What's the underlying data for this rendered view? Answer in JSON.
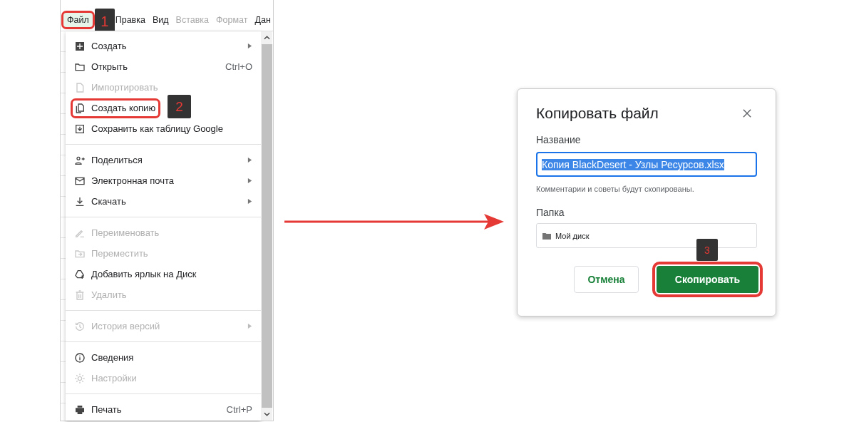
{
  "menubar": [
    {
      "label": "Файл",
      "disabled": false,
      "selected": true,
      "highlighted": true,
      "badge": "1"
    },
    {
      "label": "Правка",
      "disabled": false,
      "selected": false,
      "highlighted": false
    },
    {
      "label": "Вид",
      "disabled": false,
      "selected": false,
      "highlighted": false
    },
    {
      "label": "Вставка",
      "disabled": true,
      "selected": false,
      "highlighted": false
    },
    {
      "label": "Формат",
      "disabled": true,
      "selected": false,
      "highlighted": false
    },
    {
      "label": "Дан",
      "disabled": false,
      "selected": false,
      "highlighted": false
    }
  ],
  "menu": {
    "items": [
      {
        "kind": "item",
        "label": "Создать",
        "submenu": true,
        "disabled": false,
        "highlighted": false
      },
      {
        "kind": "item",
        "label": "Открыть",
        "shortcut": "Ctrl+O",
        "submenu": false,
        "disabled": false,
        "highlighted": false
      },
      {
        "kind": "item",
        "label": "Импортировать",
        "submenu": false,
        "disabled": true,
        "highlighted": false
      },
      {
        "kind": "item",
        "label": "Создать копию",
        "submenu": false,
        "disabled": false,
        "highlighted": true,
        "badge": "2"
      },
      {
        "kind": "item",
        "label": "Сохранить как таблицу Google",
        "submenu": false,
        "disabled": false,
        "highlighted": false
      },
      {
        "kind": "separator"
      },
      {
        "kind": "item",
        "label": "Поделиться",
        "submenu": true,
        "disabled": false,
        "highlighted": false
      },
      {
        "kind": "item",
        "label": "Электронная почта",
        "submenu": true,
        "disabled": false,
        "highlighted": false
      },
      {
        "kind": "item",
        "label": "Скачать",
        "submenu": true,
        "disabled": false,
        "highlighted": false
      },
      {
        "kind": "separator"
      },
      {
        "kind": "item",
        "label": "Переименовать",
        "submenu": false,
        "disabled": true,
        "highlighted": false
      },
      {
        "kind": "item",
        "label": "Переместить",
        "submenu": false,
        "disabled": true,
        "highlighted": false
      },
      {
        "kind": "item",
        "label": "Добавить ярлык на Диск",
        "submenu": false,
        "disabled": false,
        "highlighted": false
      },
      {
        "kind": "item",
        "label": "Удалить",
        "submenu": false,
        "disabled": true,
        "highlighted": false
      },
      {
        "kind": "separator"
      },
      {
        "kind": "item",
        "label": "История версий",
        "submenu": true,
        "disabled": true,
        "highlighted": false
      },
      {
        "kind": "separator"
      },
      {
        "kind": "item",
        "label": "Сведения",
        "submenu": false,
        "disabled": false,
        "highlighted": false
      },
      {
        "kind": "item",
        "label": "Настройки",
        "submenu": false,
        "disabled": true,
        "highlighted": false
      },
      {
        "kind": "separator"
      },
      {
        "kind": "item",
        "label": "Печать",
        "shortcut": "Ctrl+P",
        "submenu": false,
        "disabled": false,
        "highlighted": false
      }
    ]
  },
  "dialog": {
    "title": "Копировать файл",
    "name_label": "Название",
    "name_value": "Копия BlackDesert - Узлы Ресурсов.xlsx",
    "hint": "Комментарии и советы будут скопированы.",
    "folder_label": "Папка",
    "folder_value": "Мой диск",
    "buttons": [
      {
        "kind": "secondary",
        "label": "Отмена",
        "highlighted": false
      },
      {
        "kind": "primary",
        "label": "Скопировать",
        "highlighted": true,
        "badge": "3"
      }
    ]
  }
}
